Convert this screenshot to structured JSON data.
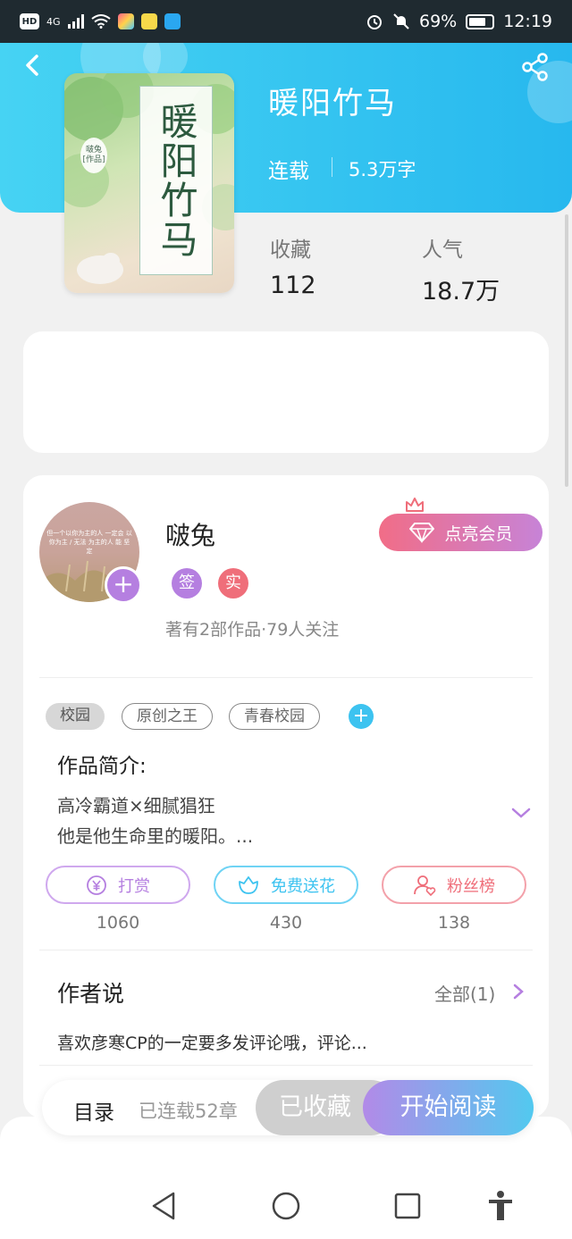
{
  "status_bar": {
    "hd": "HD",
    "network": "4G",
    "battery": "69%",
    "time": "12:19"
  },
  "book": {
    "cover_title": "暖阳竹马",
    "cover_author_name": "啵兔",
    "cover_author_note": "[作品]",
    "title": "暖阳竹马",
    "status": "连载",
    "word_count": "5.3万字",
    "stats": [
      {
        "label": "收藏",
        "value": "112"
      },
      {
        "label": "人气",
        "value": "18.7万"
      }
    ]
  },
  "author": {
    "name": "啵兔",
    "badges": [
      {
        "text": "签",
        "color": "#b57fe0"
      },
      {
        "text": "实",
        "color": "#ef6e7a"
      }
    ],
    "meta": "著有2部作品·79人关注",
    "member_button": "点亮会员",
    "avatar_text": "但一个以你为主的人 一定会 以你为主 / 无法 为主的人 能 坚定"
  },
  "tags": [
    "校园",
    "原创之王",
    "青春校园"
  ],
  "intro": {
    "heading": "作品简介:",
    "lines": [
      "高冷霸道×细腻猖狂",
      "他是他生命里的暖阳。..."
    ]
  },
  "actions": [
    {
      "label": "打赏",
      "count": "1060",
      "color": "#b57fe0",
      "icon": "yen-coin-icon"
    },
    {
      "label": "免费送花",
      "count": "430",
      "color": "#3dc3f0",
      "icon": "flower-icon"
    },
    {
      "label": "粉丝榜",
      "count": "138",
      "color": "#ef6e7a",
      "icon": "fan-user-icon"
    }
  ],
  "author_says": {
    "title": "作者说",
    "more": "全部(1)",
    "text": "喜欢彦寒CP的一定要多发评论哦，评论..."
  },
  "bottom_bar": {
    "catalog": "目录",
    "chapters": "已连载52章",
    "collected": "已收藏",
    "read": "开始阅读"
  },
  "colors": {
    "header_start": "#46d3f3",
    "header_end": "#27b8ee",
    "accent_purple": "#b57fe0",
    "accent_blue": "#3dc3f0",
    "accent_pink": "#ef6e7a"
  }
}
